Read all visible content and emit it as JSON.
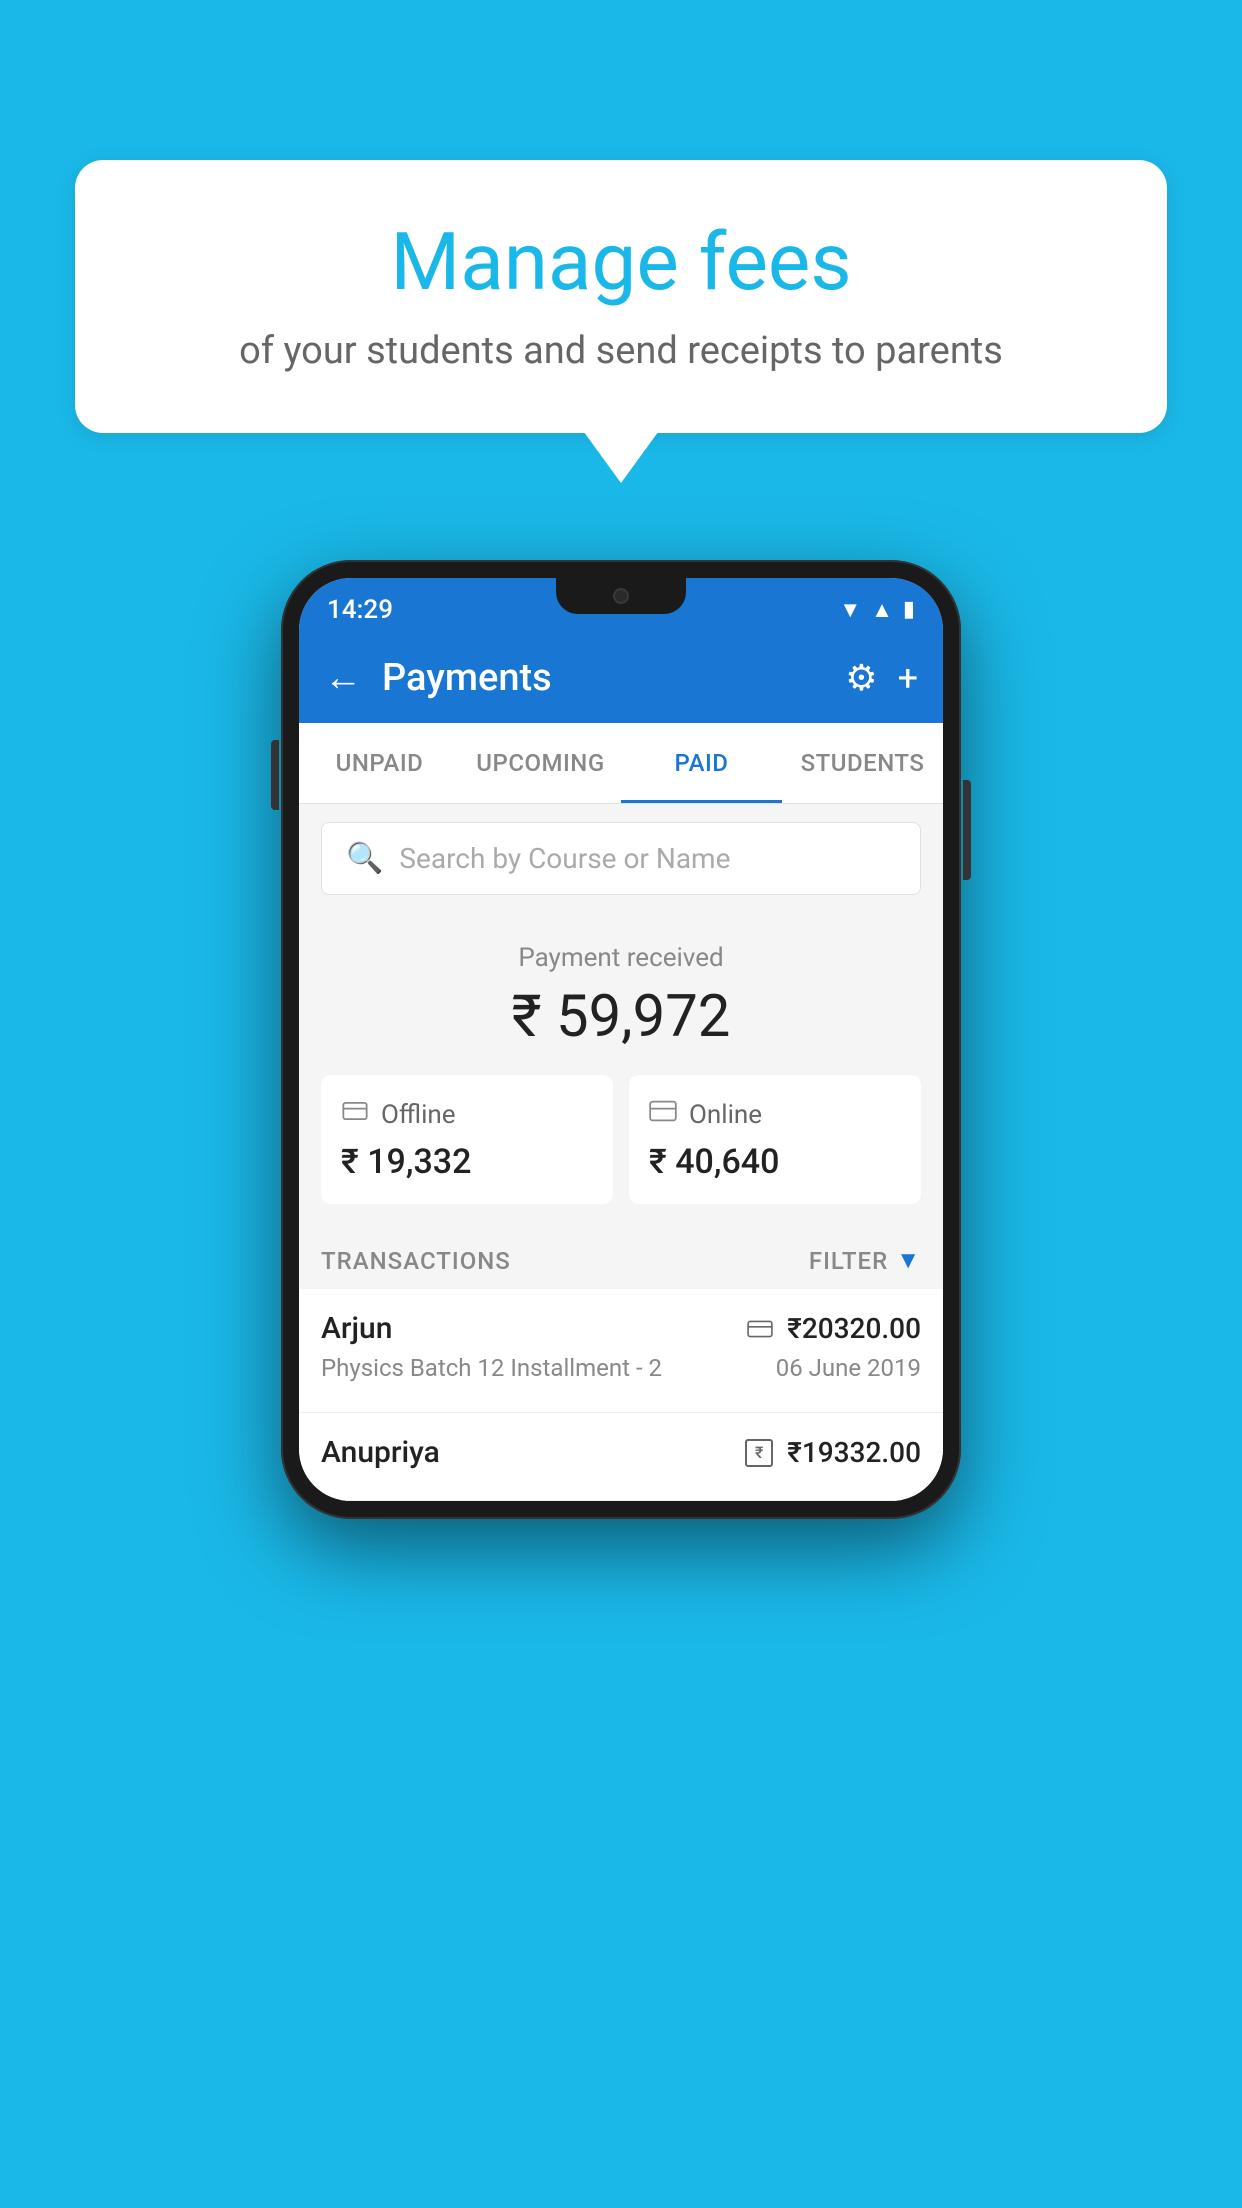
{
  "background_color": "#1ab8e8",
  "speech_bubble": {
    "title": "Manage fees",
    "subtitle": "of your students and send receipts to parents"
  },
  "status_bar": {
    "time": "14:29",
    "wifi": "▼",
    "signal": "▲",
    "battery": "▮"
  },
  "app_bar": {
    "title": "Payments",
    "back_label": "←",
    "gear_label": "⚙",
    "add_label": "+"
  },
  "tabs": [
    {
      "id": "unpaid",
      "label": "UNPAID",
      "active": false
    },
    {
      "id": "upcoming",
      "label": "UPCOMING",
      "active": false
    },
    {
      "id": "paid",
      "label": "PAID",
      "active": true
    },
    {
      "id": "students",
      "label": "STUDENTS",
      "active": false
    }
  ],
  "search": {
    "placeholder": "Search by Course or Name"
  },
  "payment_summary": {
    "label": "Payment received",
    "total": "₹ 59,972",
    "offline": {
      "label": "Offline",
      "amount": "₹ 19,332"
    },
    "online": {
      "label": "Online",
      "amount": "₹ 40,640"
    }
  },
  "transactions_section": {
    "header": "TRANSACTIONS",
    "filter_label": "FILTER"
  },
  "transactions": [
    {
      "name": "Arjun",
      "course": "Physics Batch 12 Installment - 2",
      "amount": "₹20320.00",
      "date": "06 June 2019",
      "payment_type": "card"
    },
    {
      "name": "Anupriya",
      "course": "",
      "amount": "₹19332.00",
      "date": "",
      "payment_type": "cash"
    }
  ]
}
